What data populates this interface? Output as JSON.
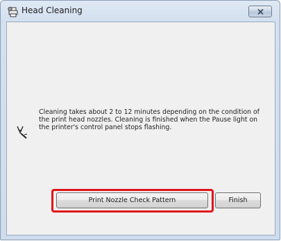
{
  "window": {
    "title": "Head Cleaning",
    "title_icon": "printer-gear-icon",
    "close_icon": "close-icon"
  },
  "content": {
    "message_icon": "pen-nozzle-icon",
    "message": "Cleaning takes about 2 to 12 minutes depending on the condition of\nthe print head nozzles. Cleaning is finished when the Pause light on\nthe printer's control panel stops flashing."
  },
  "buttons": {
    "print_nozzle_check_label": "Print Nozzle Check Pattern",
    "finish_label": "Finish"
  },
  "colors": {
    "highlight": "#e0141a",
    "titlebar": "#dfe9f5"
  }
}
